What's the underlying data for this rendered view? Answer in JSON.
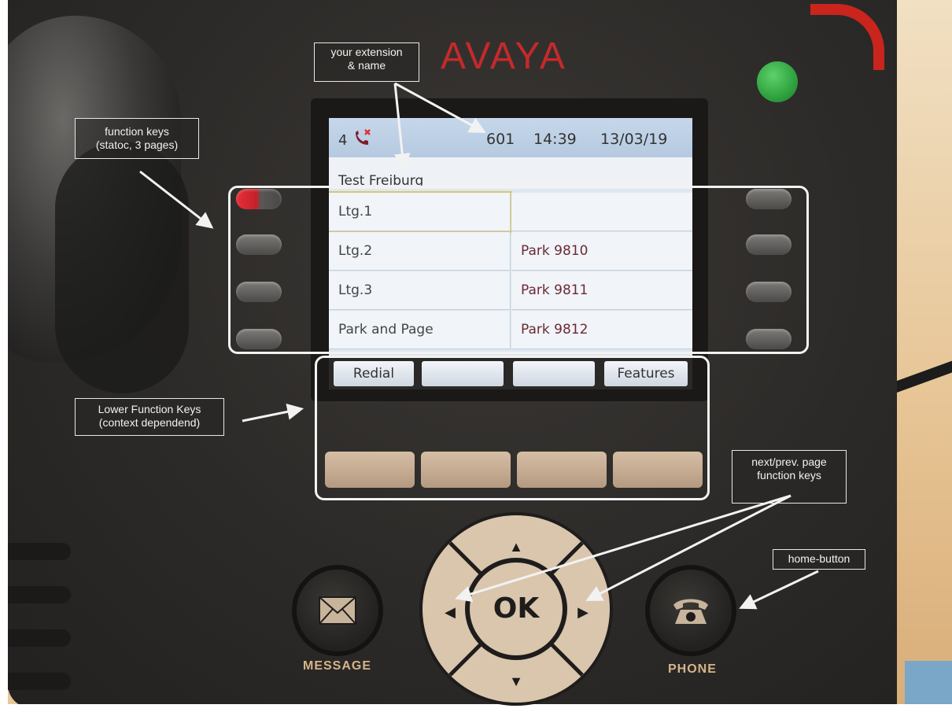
{
  "brand": "AVAYA",
  "screen": {
    "status": {
      "call_count": "4",
      "icon": "missed-call-icon",
      "extension": "601",
      "time": "14:39",
      "date": "13/03/19"
    },
    "user_name": "Test Freiburg",
    "lines_left": [
      "Ltg.1",
      "Ltg.2",
      "Ltg.3",
      "Park and Page"
    ],
    "lines_right": [
      "",
      "Park 9810",
      "Park 9811",
      "Park 9812"
    ],
    "softkeys": [
      "Redial",
      "",
      "",
      "Features"
    ]
  },
  "buttons": {
    "ok_label": "OK",
    "message_label": "MESSAGE",
    "phone_label": "PHONE"
  },
  "annotations": {
    "extension_name": [
      "your extension",
      "& name"
    ],
    "function_keys": [
      "function keys",
      "(statoc, 3 pages)"
    ],
    "lower_function_keys": [
      "Lower Function Keys",
      "(context dependend)"
    ],
    "page_keys": [
      "next/prev. page",
      "function keys"
    ],
    "home_button": "home-button"
  },
  "colors": {
    "brand_red": "#c5292a",
    "led_green": "#2fa23f",
    "line_active_red": "#e8303a",
    "button_label": "#d4b48a"
  }
}
